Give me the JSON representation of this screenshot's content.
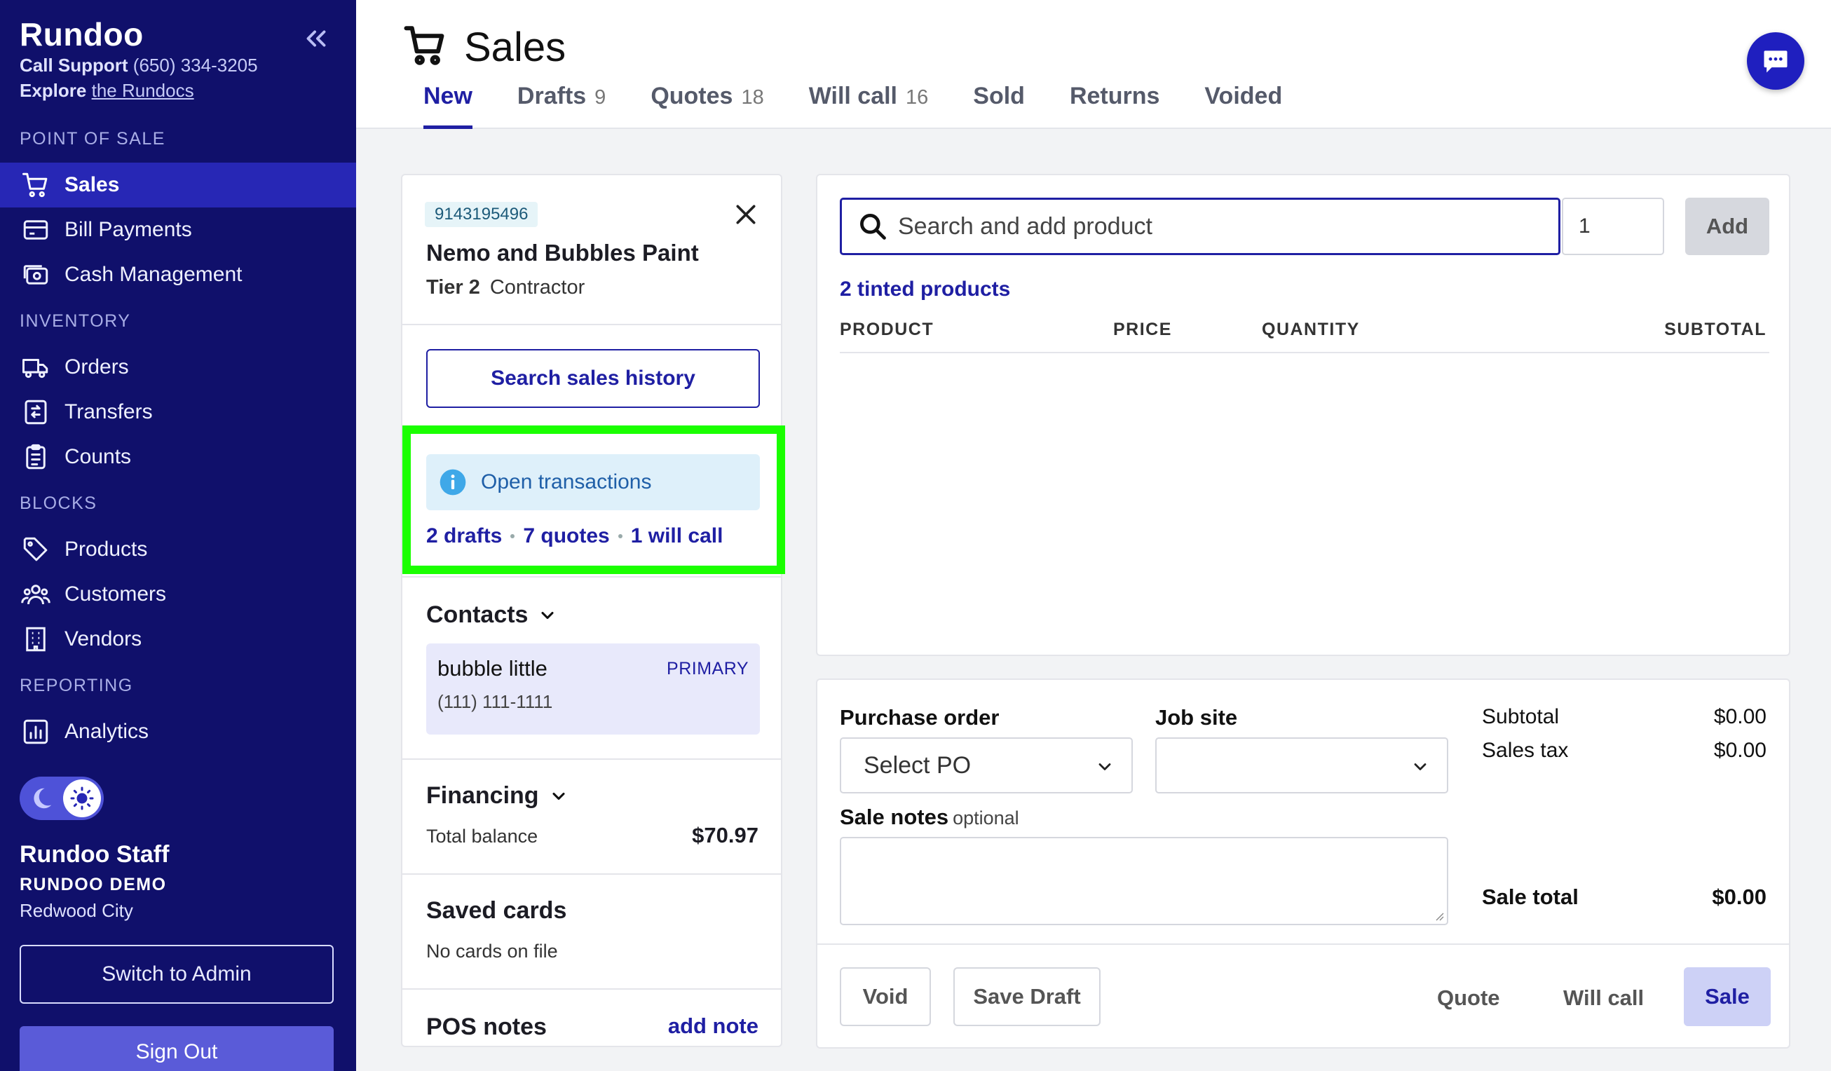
{
  "sidebar": {
    "brand": "Rundoo",
    "support_label": "Call Support",
    "support_phone": "(650) 334-3205",
    "explore_label": "Explore",
    "explore_link": "the Rundocs",
    "sections": {
      "pos": "POINT OF SALE",
      "inventory": "INVENTORY",
      "blocks": "BLOCKS",
      "reporting": "REPORTING"
    },
    "items": [
      {
        "label": "Sales",
        "icon": "cart-icon",
        "active": true
      },
      {
        "label": "Bill Payments",
        "icon": "bill-icon"
      },
      {
        "label": "Cash Management",
        "icon": "cash-icon"
      },
      {
        "label": "Orders",
        "icon": "truck-icon"
      },
      {
        "label": "Transfers",
        "icon": "transfer-icon"
      },
      {
        "label": "Counts",
        "icon": "clipboard-icon"
      },
      {
        "label": "Products",
        "icon": "tag-icon"
      },
      {
        "label": "Customers",
        "icon": "users-icon"
      },
      {
        "label": "Vendors",
        "icon": "building-icon"
      },
      {
        "label": "Analytics",
        "icon": "chart-icon"
      }
    ],
    "user": {
      "name": "Rundoo Staff",
      "org": "RUNDOO DEMO",
      "location": "Redwood City"
    },
    "switch_admin": "Switch to Admin",
    "sign_out": "Sign Out"
  },
  "header": {
    "title": "Sales",
    "tabs": [
      {
        "label": "New",
        "count": "",
        "active": true
      },
      {
        "label": "Drafts",
        "count": "9"
      },
      {
        "label": "Quotes",
        "count": "18"
      },
      {
        "label": "Will call",
        "count": "16"
      },
      {
        "label": "Sold",
        "count": ""
      },
      {
        "label": "Returns",
        "count": ""
      },
      {
        "label": "Voided",
        "count": ""
      }
    ]
  },
  "customer": {
    "account_number": "9143195496",
    "name": "Nemo and Bubbles Paint",
    "tier": "Tier 2",
    "type": "Contractor",
    "search_history": "Search sales history",
    "open_transactions": "Open transactions",
    "drafts_link": "2 drafts",
    "quotes_link": "7 quotes",
    "willcall_link": "1 will call",
    "contacts_title": "Contacts",
    "contact": {
      "name": "bubble little",
      "tag": "PRIMARY",
      "phone": "(111) 111-1111"
    },
    "financing_title": "Financing",
    "total_balance_label": "Total balance",
    "total_balance": "$70.97",
    "saved_cards_title": "Saved cards",
    "saved_cards_empty": "No cards on file",
    "pos_notes_title": "POS notes",
    "add_note": "add note"
  },
  "products": {
    "search_placeholder": "Search and add product",
    "quantity": "1",
    "add_label": "Add",
    "tinted_link": "2 tinted products",
    "columns": {
      "product": "PRODUCT",
      "price": "PRICE",
      "quantity": "QUANTITY",
      "subtotal": "SUBTOTAL"
    }
  },
  "order": {
    "po_label": "Purchase order",
    "po_value": "Select PO",
    "job_site_label": "Job site",
    "job_site_value": "",
    "notes_label": "Sale notes",
    "notes_optional": "optional",
    "subtotal_label": "Subtotal",
    "subtotal": "$0.00",
    "tax_label": "Sales tax",
    "tax": "$0.00",
    "total_label": "Sale total",
    "total": "$0.00",
    "buttons": {
      "void": "Void",
      "save_draft": "Save Draft",
      "quote": "Quote",
      "will_call": "Will call",
      "sale": "Sale"
    }
  },
  "colors": {
    "sidebar_bg": "#10106b",
    "sidebar_active": "#2727b5",
    "accent": "#1f1fa3",
    "highlight": "#1aff00"
  }
}
